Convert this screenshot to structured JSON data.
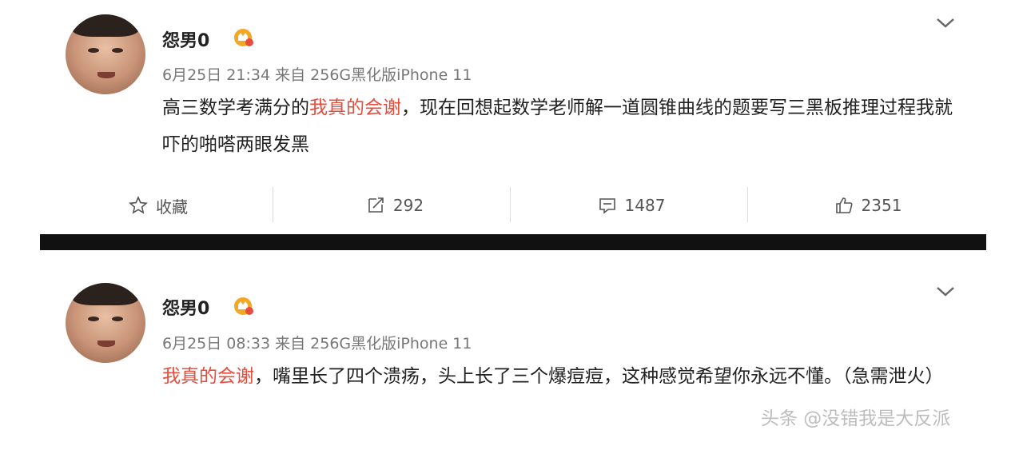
{
  "posts": [
    {
      "username": "怨男0",
      "timestamp": "6月25日 21:34",
      "source": "来自 256G黑化版iPhone 11",
      "text_prefix": "高三数学考满分的",
      "highlight": "我真的会谢",
      "text_suffix": "，现在回想起数学老师解一道圆锥曲线的题要写三黑板推理过程我就吓的啪嗒两眼发黑",
      "actions": {
        "favorite_label": "收藏",
        "repost_count": "292",
        "comment_count": "1487",
        "like_count": "2351"
      }
    },
    {
      "username": "怨男0",
      "timestamp": "6月25日 08:33",
      "source": "来自 256G黑化版iPhone 11",
      "text_prefix": "",
      "highlight": "我真的会谢",
      "text_suffix": "，嘴里长了四个溃疡，头上长了三个爆痘痘，这种感觉希望你永远不懂。（急需泄火）"
    }
  ],
  "watermark": "头条 @没错我是大反派",
  "colors": {
    "highlight": "#e74c3c",
    "accent_decor": "#f0a020",
    "divider": "#111111"
  },
  "icons": [
    "star-icon",
    "repost-icon",
    "comment-icon",
    "like-icon",
    "chevron-down-icon",
    "vip-badge-icon",
    "dog-decoration-icon"
  ]
}
